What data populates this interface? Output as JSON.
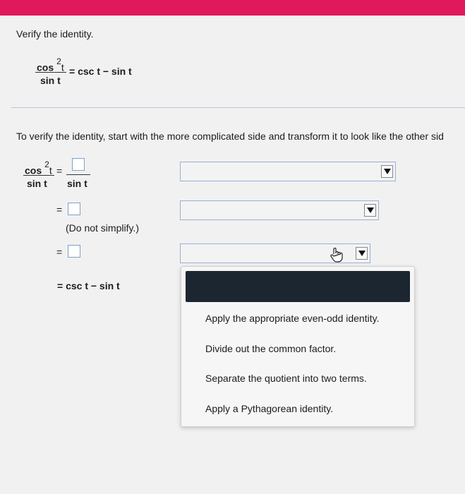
{
  "problem": {
    "instruction": "Verify the identity.",
    "lhs_numerator": "cos",
    "lhs_exponent": "2",
    "lhs_numerator_var": "t",
    "lhs_denominator": "sin t",
    "rhs": "= csc t − sin t"
  },
  "work": {
    "intro": "To verify the identity, start with the more complicated side and transform it to look like the other sid",
    "step1": {
      "lhs_numerator": "cos",
      "lhs_exponent": "2",
      "lhs_numerator_var": "t",
      "lhs_denominator": "sin t",
      "equals": "=",
      "rhs_denominator": "sin t"
    },
    "step2": {
      "equals": "=",
      "note": "(Do not simplify.)"
    },
    "step3": {
      "equals": "="
    },
    "final": "= csc t − sin t"
  },
  "dropdown_menu": {
    "options": [
      "Apply the appropriate even-odd identity.",
      "Divide out the common factor.",
      "Separate the quotient into two terms.",
      "Apply a Pythagorean identity."
    ]
  },
  "colors": {
    "top_bar": "#e0185c",
    "menu_header": "#1c2630",
    "input_border": "#7ea1c9"
  }
}
